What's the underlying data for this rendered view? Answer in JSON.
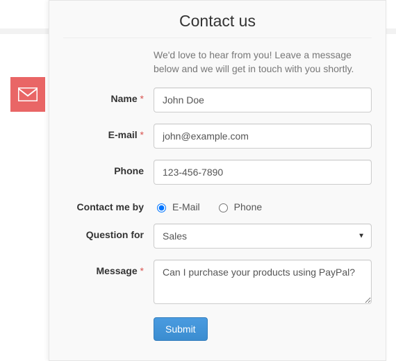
{
  "page": {
    "mail_tab_icon": "envelope-icon"
  },
  "panel": {
    "title": "Contact us",
    "intro": "We'd love to hear from you! Leave a message below and we will get in touch with you shortly."
  },
  "fields": {
    "name": {
      "label": "Name",
      "required": true,
      "value": "John Doe"
    },
    "email": {
      "label": "E-mail",
      "required": true,
      "value": "john@example.com"
    },
    "phone": {
      "label": "Phone",
      "required": false,
      "value": "123-456-7890"
    },
    "contact_by": {
      "label": "Contact me by",
      "options": {
        "email": "E-Mail",
        "phone": "Phone"
      },
      "selected": "email"
    },
    "question_for": {
      "label": "Question for",
      "selected": "Sales"
    },
    "message": {
      "label": "Message",
      "required": true,
      "value": "Can I purchase your products using PayPal?"
    }
  },
  "actions": {
    "submit_label": "Submit"
  },
  "tokens": {
    "required_mark": "*"
  }
}
